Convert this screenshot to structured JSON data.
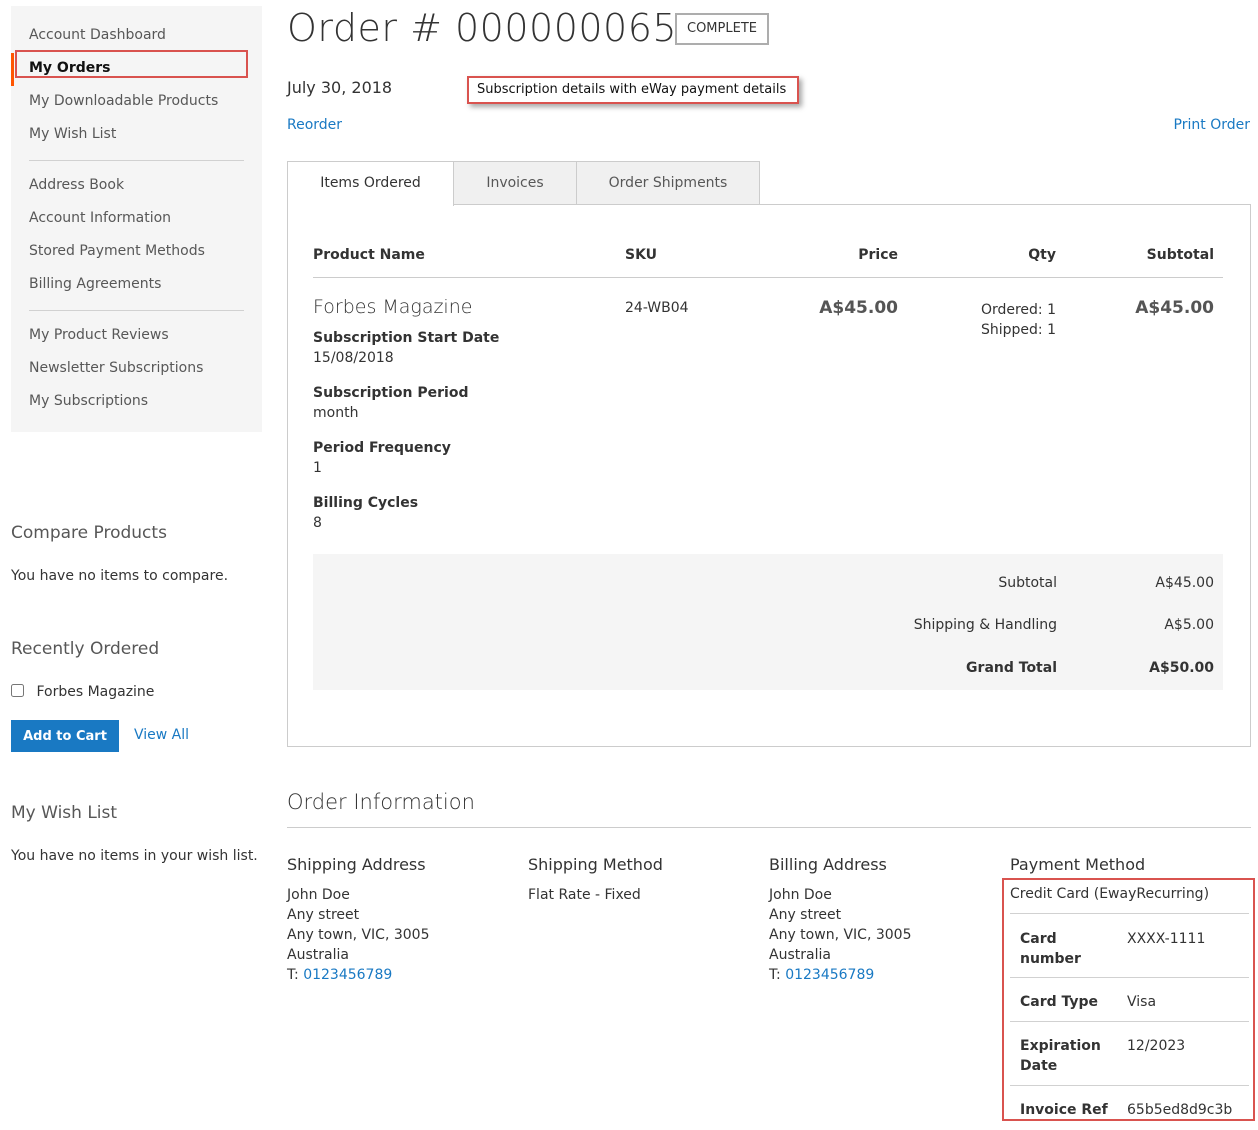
{
  "sidebar": {
    "nav_group1": [
      "Account Dashboard",
      "My Orders",
      "My Downloadable Products",
      "My Wish List"
    ],
    "nav_group2": [
      "Address Book",
      "Account Information",
      "Stored Payment Methods",
      "Billing Agreements"
    ],
    "nav_group3": [
      "My Product Reviews",
      "Newsletter Subscriptions",
      "My Subscriptions"
    ],
    "compare": {
      "title": "Compare Products",
      "empty": "You have no items to compare."
    },
    "recent": {
      "title": "Recently Ordered",
      "item": "Forbes Magazine",
      "add_to_cart": "Add to Cart",
      "view_all": "View All"
    },
    "wishlist": {
      "title": "My Wish List",
      "empty": "You have no items in your wish list."
    }
  },
  "order": {
    "title": "Order # 000000065",
    "status": "COMPLETE",
    "date": "July 30, 2018",
    "annotation": "Subscription details with eWay payment details",
    "reorder": "Reorder",
    "print": "Print Order"
  },
  "tabs": [
    "Items Ordered",
    "Invoices",
    "Order Shipments"
  ],
  "table": {
    "headers": {
      "name": "Product Name",
      "sku": "SKU",
      "price": "Price",
      "qty": "Qty",
      "subtotal": "Subtotal"
    },
    "item": {
      "name": "Forbes Magazine",
      "sku": "24-WB04",
      "price": "A$45.00",
      "qty_ordered": "Ordered: 1",
      "qty_shipped": "Shipped: 1",
      "subtotal": "A$45.00",
      "options": [
        {
          "label": "Subscription Start Date",
          "value": "15/08/2018"
        },
        {
          "label": "Subscription Period",
          "value": "month"
        },
        {
          "label": "Period Frequency",
          "value": "1"
        },
        {
          "label": "Billing Cycles",
          "value": "8"
        }
      ]
    },
    "totals": [
      {
        "label": "Subtotal",
        "value": "A$45.00"
      },
      {
        "label": "Shipping & Handling",
        "value": "A$5.00"
      },
      {
        "label": "Grand Total",
        "value": "A$50.00"
      }
    ]
  },
  "info": {
    "title": "Order Information",
    "shipping_address": {
      "title": "Shipping Address",
      "name": "John Doe",
      "street": "Any street",
      "city": "Any town, VIC, 3005",
      "country": "Australia",
      "phone_prefix": "T: ",
      "phone": "0123456789"
    },
    "shipping_method": {
      "title": "Shipping Method",
      "value": "Flat Rate - Fixed"
    },
    "billing_address": {
      "title": "Billing Address",
      "name": "John Doe",
      "street": "Any street",
      "city": "Any town, VIC, 3005",
      "country": "Australia",
      "phone_prefix": "T: ",
      "phone": "0123456789"
    },
    "payment": {
      "title": "Payment Method",
      "method": "Credit Card (EwayRecurring)",
      "card_number_label": "Card number",
      "card_number": "XXXX-1111",
      "card_type_label": "Card Type",
      "card_type": "Visa",
      "expiration_label": "Expiration Date",
      "expiration": "12/2023",
      "invoice_label": "Invoice Ref",
      "invoice": "65b5ed8d9c3b"
    }
  },
  "colors": {
    "link": "#1979c3",
    "accent": "#ff5501",
    "highlight": "#d9534f",
    "button": "#1979c3"
  }
}
